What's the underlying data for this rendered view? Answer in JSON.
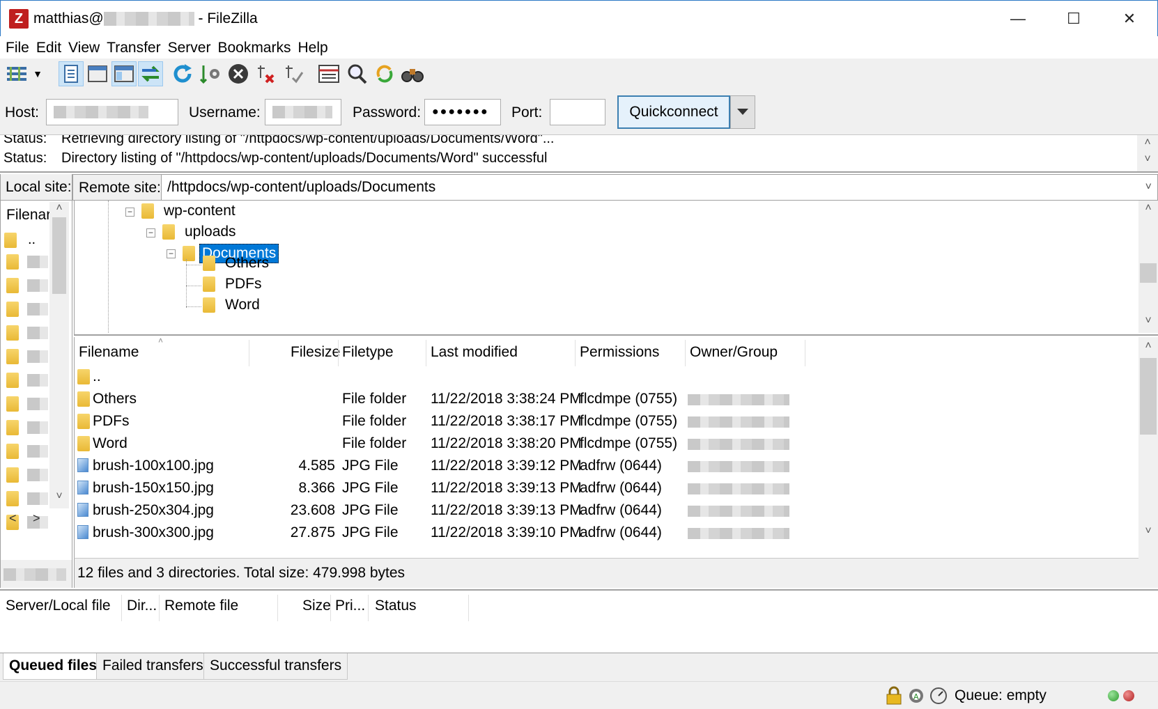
{
  "window": {
    "user_prefix": "matthias@",
    "title_suffix": "- FileZilla",
    "app_icon_letter": "Z"
  },
  "menu": [
    "File",
    "Edit",
    "View",
    "Transfer",
    "Server",
    "Bookmarks",
    "Help"
  ],
  "toolbar": {
    "icons": [
      "site-manager-icon",
      "dropdown-arrow-icon",
      "message-log-icon",
      "local-tree-icon",
      "remote-tree-icon",
      "transfer-queue-icon",
      "refresh-icon",
      "process-queue-icon",
      "cancel-icon",
      "disconnect-icon",
      "reconnect-icon",
      "directory-listing-filters-icon",
      "toggle-filter-icon",
      "synchronized-browsing-icon",
      "search-icon"
    ]
  },
  "quickconnect": {
    "host_label": "Host:",
    "username_label": "Username:",
    "password_label": "Password:",
    "password_value": "●●●●●●●",
    "port_label": "Port:",
    "port_value": "",
    "button_label": "Quickconnect"
  },
  "log": [
    {
      "label": "Status:",
      "message": "Retrieving directory listing of \"/httpdocs/wp-content/uploads/Documents/Word\"..."
    },
    {
      "label": "Status:",
      "message": "Directory listing of \"/httpdocs/wp-content/uploads/Documents/Word\" successful"
    }
  ],
  "local": {
    "site_label": "Local site:",
    "filename_header": "Filenar",
    "parent": ".."
  },
  "remote": {
    "site_label": "Remote site:",
    "path": "/httpdocs/wp-content/uploads/Documents",
    "tree": [
      {
        "name": "wp-content",
        "expanded": true
      },
      {
        "name": "uploads",
        "expanded": true
      },
      {
        "name": "Documents",
        "expanded": true,
        "selected": true
      },
      {
        "name": "Others"
      },
      {
        "name": "PDFs"
      },
      {
        "name": "Word"
      }
    ],
    "columns": [
      "Filename",
      "Filesize",
      "Filetype",
      "Last modified",
      "Permissions",
      "Owner/Group"
    ],
    "files": [
      {
        "name": "..",
        "size": "",
        "type": "",
        "modified": "",
        "perm": "",
        "kind": "folder"
      },
      {
        "name": "Others",
        "size": "",
        "type": "File folder",
        "modified": "11/22/2018 3:38:24 PM",
        "perm": "flcdmpe (0755)",
        "kind": "folder"
      },
      {
        "name": "PDFs",
        "size": "",
        "type": "File folder",
        "modified": "11/22/2018 3:38:17 PM",
        "perm": "flcdmpe (0755)",
        "kind": "folder"
      },
      {
        "name": "Word",
        "size": "",
        "type": "File folder",
        "modified": "11/22/2018 3:38:20 PM",
        "perm": "flcdmpe (0755)",
        "kind": "folder"
      },
      {
        "name": "brush-100x100.jpg",
        "size": "4.585",
        "type": "JPG File",
        "modified": "11/22/2018 3:39:12 PM",
        "perm": "adfrw (0644)",
        "kind": "image"
      },
      {
        "name": "brush-150x150.jpg",
        "size": "8.366",
        "type": "JPG File",
        "modified": "11/22/2018 3:39:13 PM",
        "perm": "adfrw (0644)",
        "kind": "image"
      },
      {
        "name": "brush-250x304.jpg",
        "size": "23.608",
        "type": "JPG File",
        "modified": "11/22/2018 3:39:13 PM",
        "perm": "adfrw (0644)",
        "kind": "image"
      },
      {
        "name": "brush-300x300.jpg",
        "size": "27.875",
        "type": "JPG File",
        "modified": "11/22/2018 3:39:10 PM",
        "perm": "adfrw (0644)",
        "kind": "image"
      }
    ],
    "summary": "12 files and 3 directories. Total size: 479.998 bytes"
  },
  "queue": {
    "columns": [
      "Server/Local file",
      "Dir...",
      "Remote file",
      "Size",
      "Pri...",
      "Status"
    ],
    "tabs": [
      "Queued files",
      "Failed transfers",
      "Successful transfers"
    ]
  },
  "statusbar": {
    "queue_text": "Queue: empty",
    "icons": [
      "lock-icon",
      "settings-gear-icon",
      "speed-limit-icon"
    ],
    "lights": {
      "recv": "#2e9b2e",
      "send": "#b02020"
    }
  },
  "colors": {
    "selection": "#0078d7",
    "accent": "#2b78c5"
  }
}
